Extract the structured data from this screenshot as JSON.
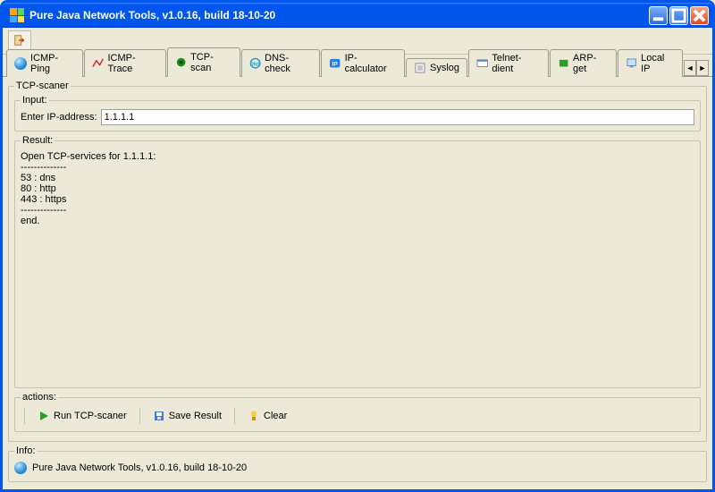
{
  "window": {
    "title": "Pure Java Network Tools,  v1.0.16, build 18-10-20"
  },
  "tabs": {
    "items": [
      {
        "label": "ICMP-Ping"
      },
      {
        "label": "ICMP-Trace"
      },
      {
        "label": "TCP-scan"
      },
      {
        "label": "DNS-check"
      },
      {
        "label": "IP-calculator"
      },
      {
        "label": "Syslog"
      },
      {
        "label": "Telnet-dient"
      },
      {
        "label": "ARP-get"
      },
      {
        "label": "Local IP"
      }
    ],
    "active_index": 2
  },
  "scanner": {
    "legend": "TCP-scaner",
    "input_legend": "Input:",
    "input_label": "Enter IP-address:",
    "input_value": "1.1.1.1",
    "result_legend": "Result:",
    "result_text": "Open TCP-services for 1.1.1.1:\n--------------\n53 : dns\n80 : http\n443 : https\n--------------\nend."
  },
  "actions": {
    "legend": "actions:",
    "run_label": "Run TCP-scaner",
    "save_label": "Save Result",
    "clear_label": "Clear"
  },
  "info": {
    "legend": "Info:",
    "text": "Pure Java Network Tools,  v1.0.16, build 18-10-20"
  }
}
